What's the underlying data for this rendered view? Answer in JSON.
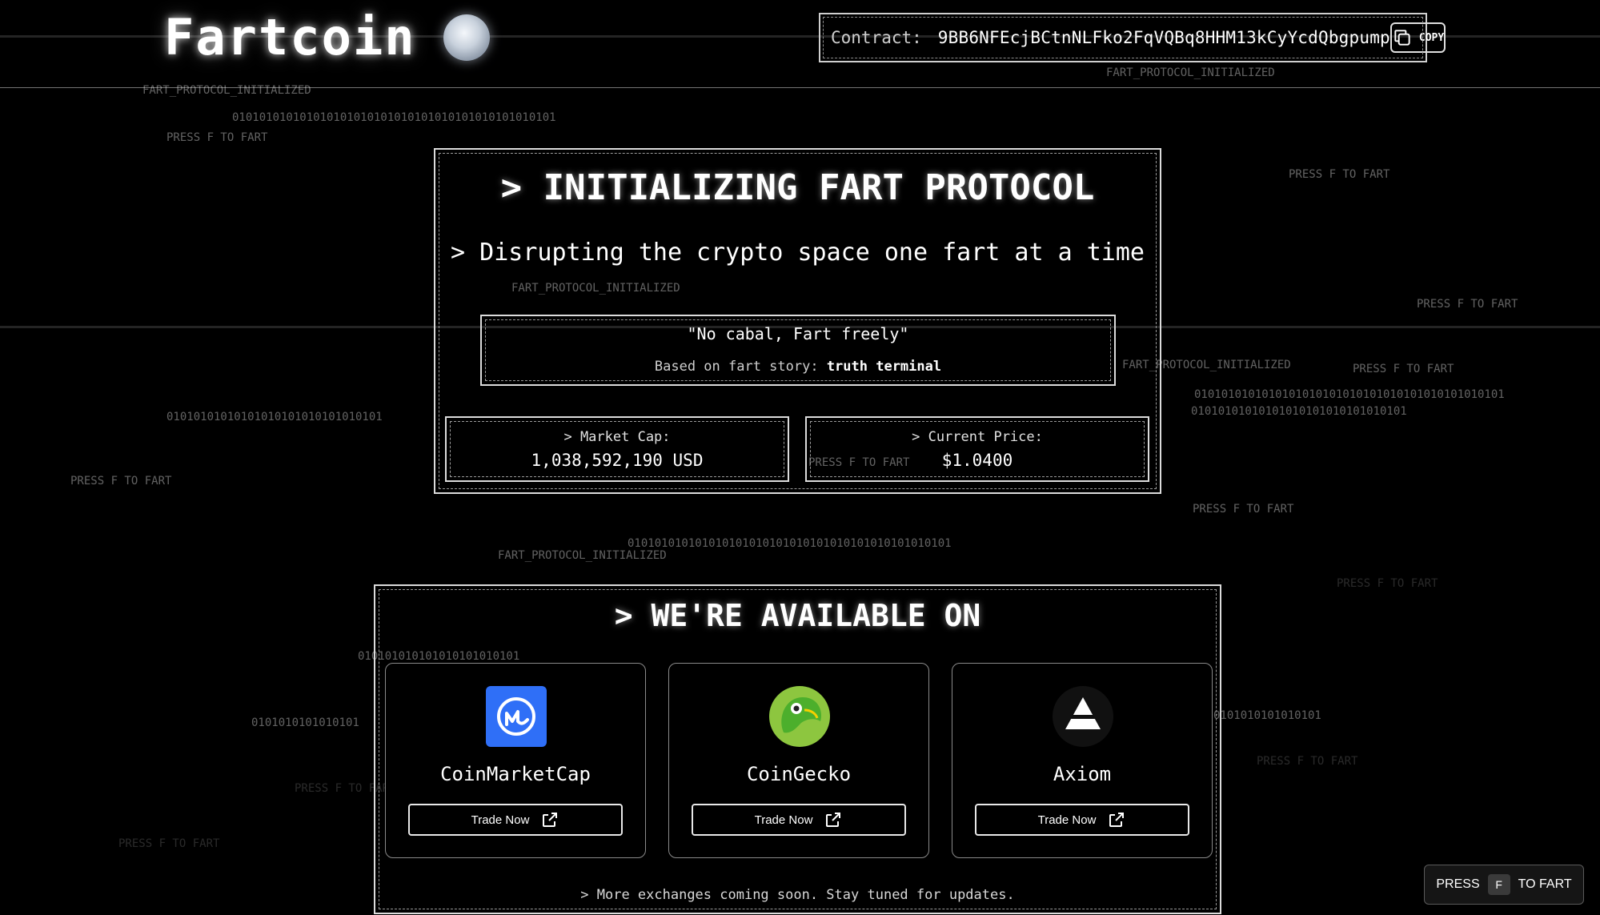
{
  "header": {
    "brand": "Fartcoin",
    "brand_icon": "cloud-puff-icon",
    "contract_label": "Contract:",
    "contract_address": "9BB6NFEcjBCtnNLFko2FqVQBq8HHM13kCyYcdQbgpump",
    "copy_label": "COPY"
  },
  "background_text": {
    "protocol": "FART_PROTOCOL_INITIALIZED",
    "press": "PRESS F TO FART",
    "binary_long": "010101010101010101010101010101010101010101010101",
    "binary_medium": "01010101010101010101010101010101",
    "binary_short": "010101010101010101010101",
    "binary_tiny": "0101010101010101",
    "binary_right2": "0101010101010101010101010101010101010101010101",
    "binary_right3": "01010101010101010101010101010101"
  },
  "hero": {
    "title": "> INITIALIZING FART PROTOCOL",
    "subtitle": "> Disrupting the crypto space one fart at a time",
    "quote": "\"No cabal, Fart freely\"",
    "story_prefix": "Based on fart story: ",
    "story_link": "truth terminal"
  },
  "stats": {
    "market_cap_label": "> Market Cap:",
    "market_cap_value": "1,038,592,190 USD",
    "price_label": "> Current Price:",
    "price_value": "$1.0400"
  },
  "exchanges": {
    "title": "> WE'RE AVAILABLE ON",
    "items": [
      {
        "name": "CoinMarketCap",
        "icon": "coinmarketcap-logo-icon",
        "button": "Trade Now"
      },
      {
        "name": "CoinGecko",
        "icon": "coingecko-logo-icon",
        "button": "Trade Now"
      },
      {
        "name": "Axiom",
        "icon": "axiom-logo-icon",
        "button": "Trade Now"
      }
    ],
    "footer": "> More exchanges coming soon. Stay tuned for updates."
  },
  "press_widget": {
    "before": "PRESS",
    "key": "F",
    "after": "TO FART"
  },
  "colors": {
    "background": "#000000",
    "text": "#ffffff",
    "coinmarketcap_blue": "#2f6ff7",
    "coingecko_green": "#8dc63f"
  }
}
